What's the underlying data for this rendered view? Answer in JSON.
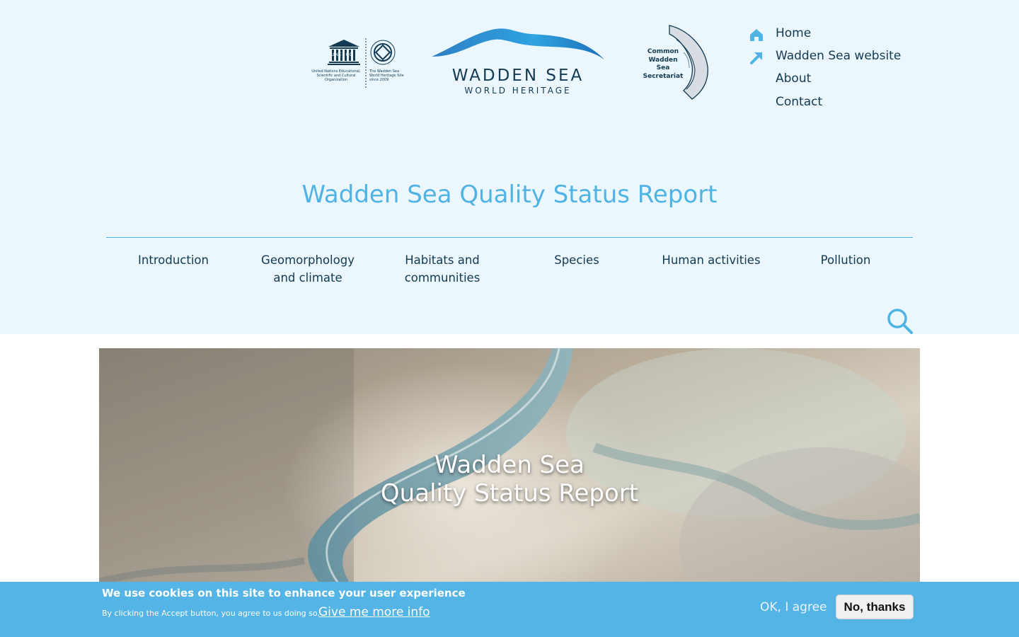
{
  "colors": {
    "header_bg": "#ebf7fd",
    "accent": "#4fb4e3",
    "text": "#123a52",
    "cookie_bg": "#54b4e5"
  },
  "logos": {
    "unesco": {
      "wordmark": "UNESCO",
      "org_text": "United Nations Educational, Scientific and Cultural Organization",
      "site_text": "The Wadden Sea World Heritage Site since 2009"
    },
    "wadden": {
      "line1": "WADDEN SEA",
      "line2": "WORLD HERITAGE"
    },
    "cwss": {
      "text": "Common Wadden Sea Secretariat"
    }
  },
  "top_nav": [
    {
      "label": "Home",
      "icon": "home-icon"
    },
    {
      "label": "Wadden Sea website",
      "icon": "external-arrow-icon"
    },
    {
      "label": "About"
    },
    {
      "label": "Contact"
    }
  ],
  "site_title": "Wadden Sea Quality Status Report",
  "main_nav": [
    {
      "label": "Introduction"
    },
    {
      "label": "Geomorphology and climate"
    },
    {
      "label": "Habitats and communities"
    },
    {
      "label": "Species"
    },
    {
      "label": "Human activities"
    },
    {
      "label": "Pollution"
    }
  ],
  "search": {
    "icon": "search-icon"
  },
  "hero": {
    "title_line1": "Wadden Sea",
    "title_line2": "Quality Status Report"
  },
  "cookie": {
    "message": "We use cookies on this site to enhance your user experience",
    "subtext": "By clicking the Accept button, you agree to us doing so.",
    "more_info": "Give me more info",
    "ok": "OK, I agree",
    "no": "No, thanks"
  }
}
